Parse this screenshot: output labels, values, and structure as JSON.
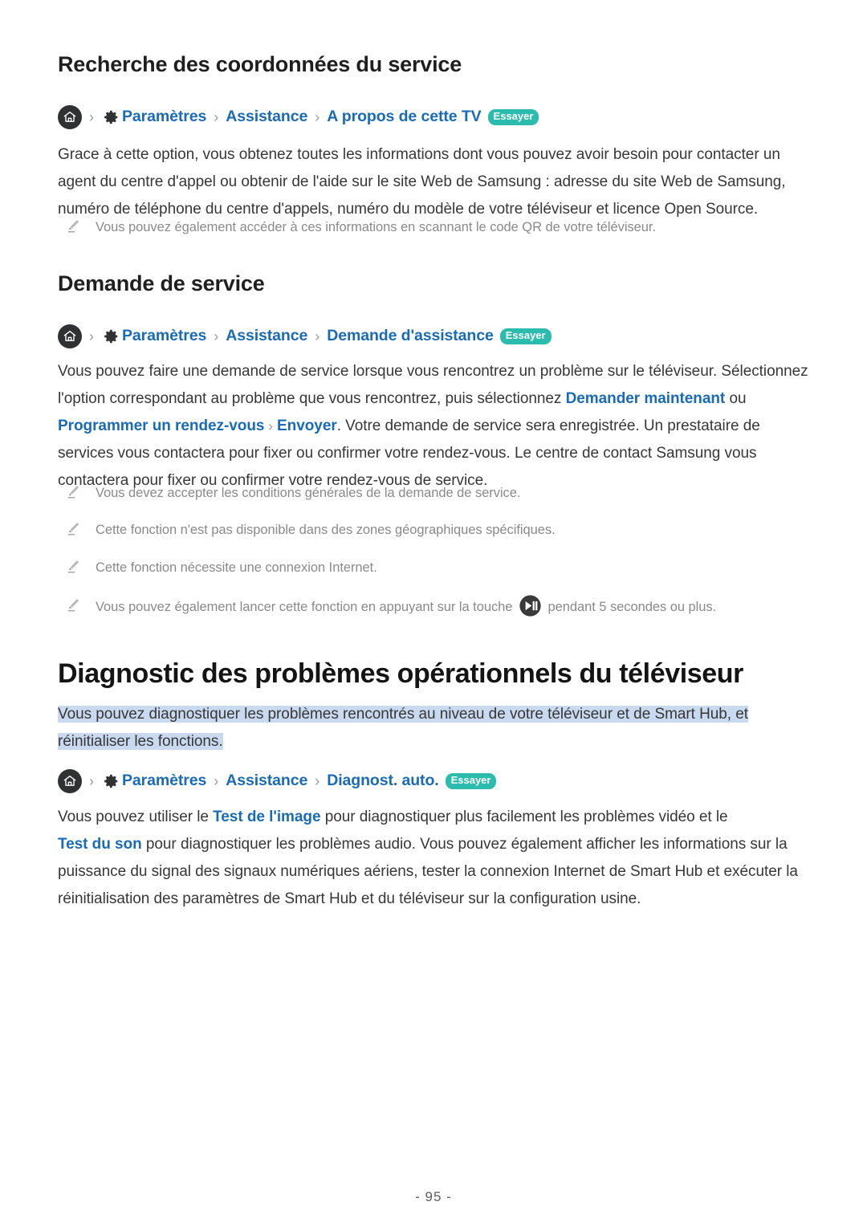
{
  "document": {
    "language": "fr",
    "footer_page_number": "- 95 -",
    "accent_link_color": "#1a6bb5",
    "badge_color": "#2cbcad",
    "highlight_color": "#c9d9ef"
  },
  "sections": [
    {
      "id": "service-contact",
      "title": "Recherche des coordonnées du service",
      "breadcrumb": {
        "home_icon": "home-icon",
        "gear_icon": "gear-icon",
        "separator": "›",
        "items": [
          "Paramètres",
          "Assistance",
          "A propos de cette TV"
        ],
        "badge": "Essayer"
      },
      "paragraph": "Grace à cette option, vous obtenez toutes les informations dont vous pouvez avoir besoin pour contacter un agent du centre d'appel ou obtenir de l'aide sur le site Web de Samsung : adresse du site Web de Samsung, numéro de téléphone du centre d'appels, numéro du modèle de votre téléviseur et licence Open Source.",
      "notes": [
        "Vous pouvez également accéder à ces informations en scannant le code QR de votre téléviseur."
      ]
    },
    {
      "id": "service-request",
      "title": "Demande de service",
      "breadcrumb": {
        "home_icon": "home-icon",
        "gear_icon": "gear-icon",
        "separator": "›",
        "items": [
          "Paramètres",
          "Assistance",
          "Demande d'assistance"
        ],
        "badge": "Essayer"
      },
      "paragraph_parts": {
        "t1": "Vous pouvez faire une demande de service lorsque vous rencontrez un problème sur le téléviseur. Sélectionnez l'option correspondant au problème que vous rencontrez, puis sélectionnez ",
        "link1": "Demander maintenant",
        "t2": " ou ",
        "link2": "Programmer un rendez-vous",
        "sep": "›",
        "link3": "Envoyer",
        "t3": ". Votre demande de service sera enregistrée. Un prestataire de services vous contactera pour fixer ou confirmer votre rendez-vous. Le centre de contact Samsung vous contactera pour fixer ou confirmer votre rendez-vous de service."
      },
      "notes": [
        "Vous devez accepter les conditions générales de la demande de service.",
        "Cette fonction n'est pas disponible dans des zones géographiques spécifiques.",
        "Cette fonction nécessite une connexion Internet."
      ],
      "note_with_icon": {
        "before": "Vous pouvez également lancer cette fonction en appuyant sur la touche ",
        "icon": "play-pause-icon",
        "after": " pendant 5 secondes ou plus."
      }
    },
    {
      "id": "tv-diagnostics",
      "chapter_title": "Diagnostic des problèmes opérationnels du téléviseur",
      "highlighted_paragraph": "Vous pouvez diagnostiquer les problèmes rencontrés au niveau de votre téléviseur et de Smart Hub, et réinitialiser les fonctions.",
      "breadcrumb": {
        "home_icon": "home-icon",
        "gear_icon": "gear-icon",
        "separator": "›",
        "items": [
          "Paramètres",
          "Assistance",
          "Diagnost. auto."
        ],
        "badge": "Essayer"
      },
      "paragraph_parts": {
        "t1": "Vous pouvez utiliser le ",
        "link1": "Test de l'image",
        "t2": " pour diagnostiquer plus facilement les problèmes vidéo et le ",
        "link2": "Test du son",
        "t3": " pour diagnostiquer les problèmes audio. Vous pouvez également afficher les informations sur la puissance du signal des signaux numériques aériens, tester la connexion Internet de Smart Hub et exécuter la réinitialisation des paramètres de Smart Hub et du téléviseur sur la configuration usine."
      }
    }
  ]
}
